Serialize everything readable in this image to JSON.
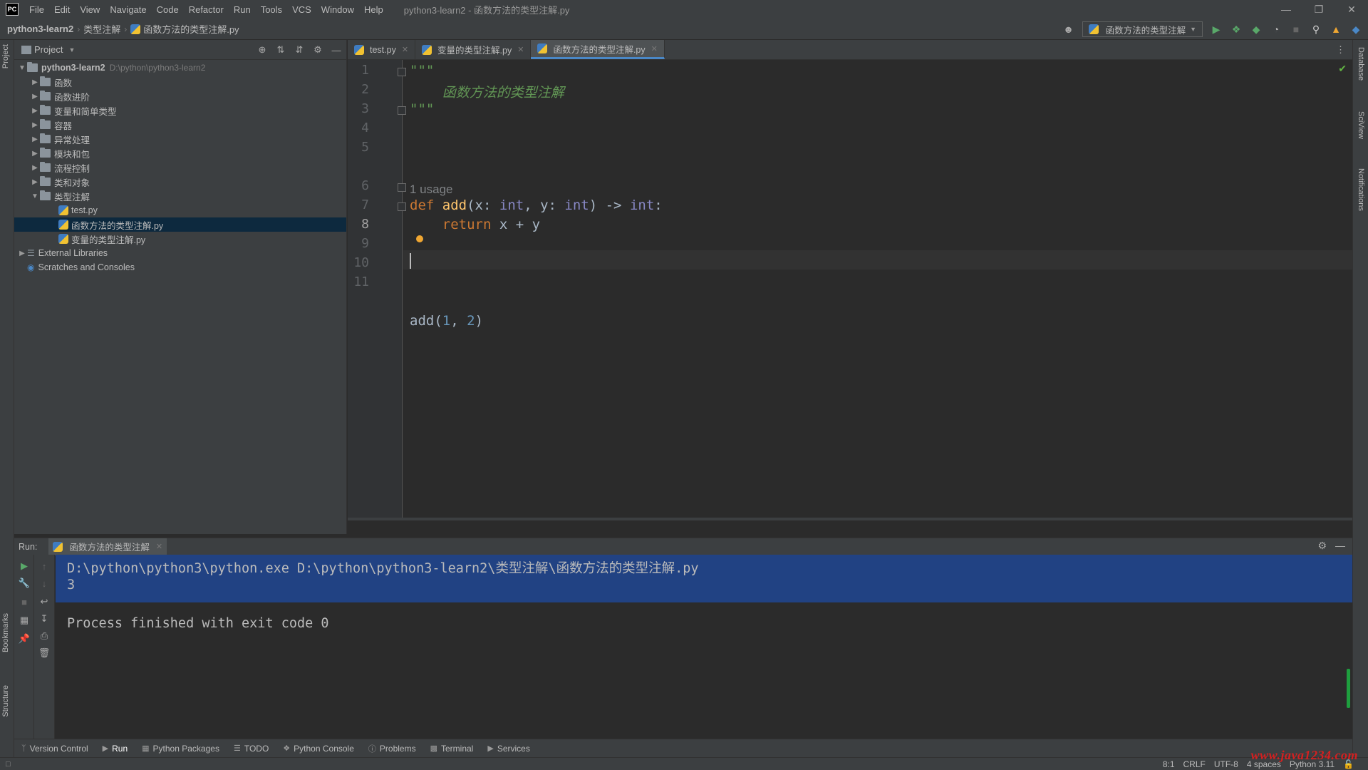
{
  "app": {
    "logo": "PC",
    "window_title": "python3-learn2 - 函数方法的类型注解.py"
  },
  "menu": [
    "File",
    "Edit",
    "View",
    "Navigate",
    "Code",
    "Refactor",
    "Run",
    "Tools",
    "VCS",
    "Window",
    "Help"
  ],
  "breadcrumb": [
    "python3-learn2",
    "类型注解",
    "函数方法的类型注解.py"
  ],
  "run_config": {
    "label": "函数方法的类型注解"
  },
  "project_panel": {
    "title": "Project",
    "tree": [
      {
        "label": "python3-learn2",
        "hint": "D:\\python\\python3-learn2",
        "type": "root",
        "expanded": true
      },
      {
        "label": "函数",
        "type": "folder"
      },
      {
        "label": "函数进阶",
        "type": "folder"
      },
      {
        "label": "变量和简单类型",
        "type": "folder"
      },
      {
        "label": "容器",
        "type": "folder"
      },
      {
        "label": "异常处理",
        "type": "folder"
      },
      {
        "label": "模块和包",
        "type": "folder"
      },
      {
        "label": "流程控制",
        "type": "folder"
      },
      {
        "label": "类和对象",
        "type": "folder"
      },
      {
        "label": "类型注解",
        "type": "folder",
        "expanded": true
      },
      {
        "label": "test.py",
        "type": "file"
      },
      {
        "label": "函数方法的类型注解.py",
        "type": "file",
        "selected": true
      },
      {
        "label": "变量的类型注解.py",
        "type": "file"
      },
      {
        "label": "External Libraries",
        "type": "lib"
      },
      {
        "label": "Scratches and Consoles",
        "type": "scratch"
      }
    ]
  },
  "editor_tabs": [
    {
      "label": "test.py",
      "active": false
    },
    {
      "label": "变量的类型注解.py",
      "active": false
    },
    {
      "label": "函数方法的类型注解.py",
      "active": true
    }
  ],
  "editor": {
    "line_numbers": [
      "1",
      "2",
      "3",
      "4",
      "5",
      "6",
      "7",
      "8",
      "9",
      "10",
      "11"
    ],
    "current_line": "8",
    "usage_hint": "1 usage",
    "code": {
      "l1": "\"\"\"",
      "l2": "    函数方法的类型注解",
      "l3": "\"\"\"",
      "l6_def": "def",
      "l6_name": "add",
      "l6_open": "(x: ",
      "l6_int1": "int",
      "l6_mid": ", y: ",
      "l6_int2": "int",
      "l6_arrow": ") -> ",
      "l6_int3": "int",
      "l6_colon": ":",
      "l7_ret": "return",
      "l7_expr": " x + y",
      "l10_call": "add(",
      "l10_a": "1",
      "l10_comma": ", ",
      "l10_b": "2",
      "l10_close": ")"
    }
  },
  "run_panel": {
    "label": "Run:",
    "tab": "函数方法的类型注解",
    "console": [
      "D:\\python\\python3\\python.exe D:\\python\\python3-learn2\\类型注解\\函数方法的类型注解.py",
      "3",
      "",
      "Process finished with exit code 0"
    ]
  },
  "bottom_tabs": [
    "Version Control",
    "Run",
    "Python Packages",
    "TODO",
    "Python Console",
    "Problems",
    "Terminal",
    "Services"
  ],
  "left_stripe": {
    "top": "Project",
    "bookmarks": "Bookmarks",
    "structure": "Structure"
  },
  "right_stripe": [
    "Database",
    "SciView",
    "Notifications"
  ],
  "status": {
    "position": "8:1",
    "line_sep": "CRLF",
    "encoding": "UTF-8",
    "indent": "4 spaces",
    "interpreter": "Python 3.11"
  },
  "watermark": "www.java1234.com",
  "colors": {
    "accent": "#4a88c7",
    "keyword": "#cc7832",
    "function": "#ffc66d",
    "builtin": "#8888c6",
    "number": "#6897bb",
    "docstring": "#629755",
    "selection": "#214283"
  }
}
